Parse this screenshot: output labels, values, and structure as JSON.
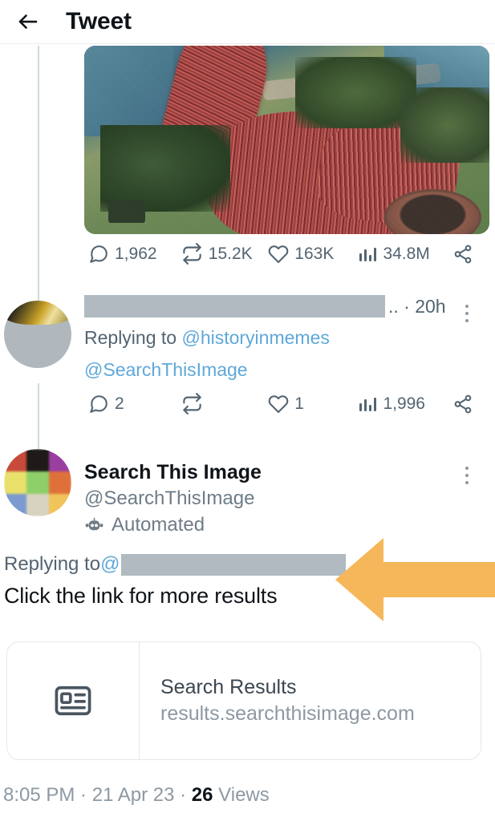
{
  "header": {
    "back_icon": "arrow-left-icon",
    "title": "Tweet"
  },
  "tweet_1": {
    "media_alt": "aerial photo of a massive crowd marching along a coastline",
    "metrics": {
      "reply_icon": "comment-icon",
      "reply_count": "1,962",
      "retweet_icon": "retweet-icon",
      "retweet_count": "15.2K",
      "like_icon": "heart-icon",
      "like_count": "163K",
      "views_icon": "analytics-icon",
      "views_count": "34.8M",
      "share_icon": "share-icon"
    }
  },
  "tweet_2": {
    "display_name": "",
    "name_redacted": true,
    "name_suffix": ".. · 20h",
    "more_icon": "more-vertical-icon",
    "replying_prefix": "Replying to ",
    "reply_handle_1": "@historyinmemes",
    "reply_handle_2": "@SearchThisImage",
    "metrics": {
      "reply_icon": "comment-icon",
      "reply_count": "2",
      "retweet_icon": "retweet-icon",
      "retweet_count": "",
      "like_icon": "heart-icon",
      "like_count": "1",
      "views_icon": "analytics-icon",
      "views_count": "1,996",
      "share_icon": "share-icon"
    }
  },
  "tweet_3": {
    "display_name": "Search This Image",
    "handle": "@SearchThisImage",
    "automated_icon": "robot-icon",
    "automated_label": "Automated",
    "more_icon": "more-vertical-icon",
    "replying_prefix": "Replying to ",
    "replying_at": "@",
    "replying_handle_redacted": true,
    "body_text": "Click the link for more results",
    "link_card": {
      "thumb_icon": "article-card-icon",
      "title": "Search Results",
      "url": "results.searchthisimage.com"
    },
    "footer": {
      "time": "8:05 PM",
      "sep1": " · ",
      "date": "21 Apr 23",
      "sep2": " · ",
      "views_count": "26",
      "views_label": " Views"
    }
  },
  "annotation": {
    "arrow_icon": "left-arrow-annotation",
    "color": "#f5b75a"
  },
  "colors": {
    "link_blue": "#5fa8d8",
    "muted_text": "#536471",
    "primary_text": "#0f1419",
    "redaction": "#b0bac0",
    "divider": "#e4e7ea",
    "annotation_orange": "#f5b75a"
  },
  "avatar3_tiles": [
    "#c84a3a",
    "#1d1a18",
    "#9a3fa0",
    "#e8e06a",
    "#8fcf6a",
    "#e0703a",
    "#7a9ad0",
    "#d8d2c0",
    "#f0c45a",
    "#4a8a5a",
    "#c4d26a",
    "#2a2a2a"
  ]
}
